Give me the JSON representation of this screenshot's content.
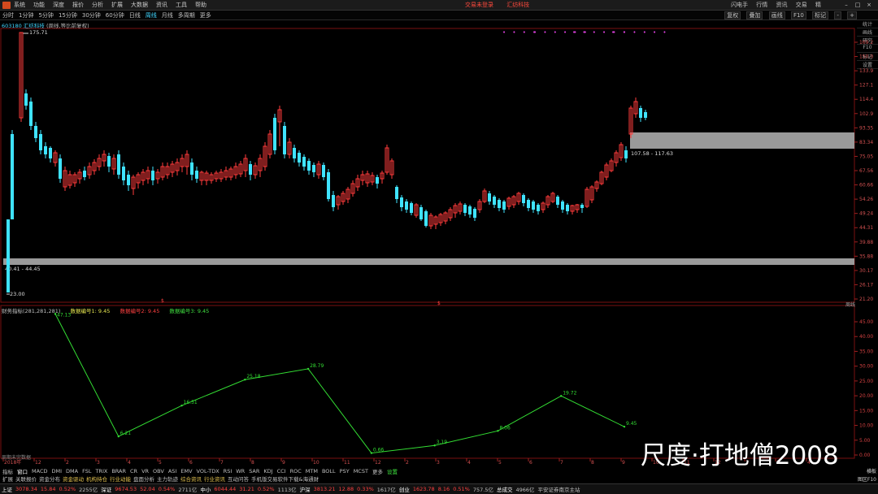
{
  "menubar": {
    "items": [
      "系统",
      "功能",
      "深度",
      "报价",
      "分析",
      "扩展",
      "大数据",
      "资讯",
      "工具",
      "帮助"
    ],
    "center": [
      "交易未登录",
      "汇纺科技"
    ],
    "right": [
      "闪电手",
      "行情",
      "资讯",
      "交易",
      "精"
    ]
  },
  "toolbar": {
    "periods": [
      "分时",
      "1分钟",
      "5分钟",
      "15分钟",
      "30分钟",
      "60分钟",
      "日线",
      "周线",
      "月线",
      "多周期",
      "更多"
    ],
    "active": "周线",
    "right": [
      "叠加",
      "画线",
      "F10",
      "标记",
      "-",
      "+"
    ],
    "right_first": "复权"
  },
  "vtoolbar": [
    "统计",
    "画线",
    "研究",
    "F10",
    "标记",
    "设置"
  ],
  "stock": {
    "code": "603180",
    "name": "汇纺科技",
    "mode": "(周线,等比前复权)"
  },
  "price_axis": [
    "169.2",
    "150.0",
    "133.9",
    "127.1",
    "114.4",
    "102.9",
    "93.35",
    "83.34",
    "75.05",
    "67.56",
    "60.66",
    "54.26",
    "49.24",
    "44.31",
    "39.88",
    "35.88",
    "30.17",
    "26.17",
    "21.20"
  ],
  "annotations": {
    "high_price": "175.71",
    "low_price": "23.00",
    "zone_upper": "107.58 - 117.63",
    "zone_lower": "40.41 - 44.45",
    "marker": "$"
  },
  "indicator": {
    "title": "财务指标(281,281,281)",
    "items": [
      "数据编号1: 9.45",
      "数据编号2: 9.45",
      "数据编号3: 9.45"
    ],
    "axis": [
      "45.00",
      "40.00",
      "35.00",
      "30.00",
      "25.00",
      "20.00",
      "15.00",
      "10.00",
      "5.00",
      "0.00"
    ],
    "points_labels": [
      "47.13",
      "6.21",
      "16.51",
      "25.18",
      "28.79",
      "0.66",
      "3.19",
      "8.06",
      "19.72",
      "9.45"
    ],
    "nodata": "周期未完数据"
  },
  "chart_data": {
    "type": "line",
    "series": [
      {
        "x": [
          1,
          2,
          3,
          4,
          5,
          6,
          7,
          8,
          9,
          10
        ],
        "values": [
          47.13,
          6.21,
          16.51,
          25.18,
          28.79,
          0.66,
          3.19,
          8.06,
          19.72,
          9.45
        ]
      }
    ],
    "ylim": [
      0,
      47.5
    ]
  },
  "time_axis": [
    "2018年",
    "12",
    "2",
    "3",
    "4",
    "5",
    "6",
    "7",
    "8",
    "9",
    "10",
    "11",
    "12",
    "2",
    "3",
    "4",
    "5",
    "6",
    "7",
    "8",
    "9",
    "10",
    "11",
    "12",
    "2",
    "3",
    "4"
  ],
  "week_label": "周线",
  "tabs": [
    "指标",
    "窗口",
    "MACD",
    "DMI",
    "DMA",
    "FSL",
    "TRIX",
    "BRAR",
    "CR",
    "VR",
    "OBV",
    "ASI",
    "EMV",
    "VOL-TDX",
    "RSI",
    "WR",
    "SAR",
    "KDJ",
    "CCI",
    "ROC",
    "MTM",
    "BOLL",
    "PSY",
    "MCST",
    "更多",
    "设置"
  ],
  "ext": [
    "扩展",
    "关联报价",
    "资金分布",
    "资金驱动",
    "机构持仓",
    "行业动能",
    "盘面分析",
    "主力轨迹",
    "综合资讯",
    "行业资讯",
    "互动问答",
    "手机版交易软件下载&海通财"
  ],
  "page": [
    "横板",
    "图区F10"
  ],
  "status": {
    "sh_label": "上证",
    "sh": "3078.34",
    "sh_chg": "15.84",
    "sh_pct": "0.52%",
    "sh_amt": "2255亿",
    "sz_label": "深证",
    "sz": "9674.53",
    "sz_chg": "52.04",
    "sz_pct": "0.54%",
    "sz_amt": "2711亿",
    "zx_label": "中小",
    "zx": "6044.44",
    "zx_chg": "31.21",
    "zx_pct": "0.52%",
    "zx_amt": "1113亿",
    "hs_label": "沪深",
    "hs": "3813.21",
    "hs_chg": "12.88",
    "hs_pct": "0.33%",
    "hs_amt": "1617亿",
    "cy_label": "创业",
    "cy": "1623.78",
    "cy_chg": "8.16",
    "cy_pct": "0.51%",
    "cy_amt": "757.5亿",
    "total_label": "总成交",
    "total": "4966亿",
    "broker": "平安证券南京主站"
  },
  "watermark": "尺度·打地僧2008",
  "colors": {
    "up": "#ff3b3b",
    "down": "#3fe3ff",
    "indicator": "#33dd33",
    "zone": "#9a9a9a"
  }
}
